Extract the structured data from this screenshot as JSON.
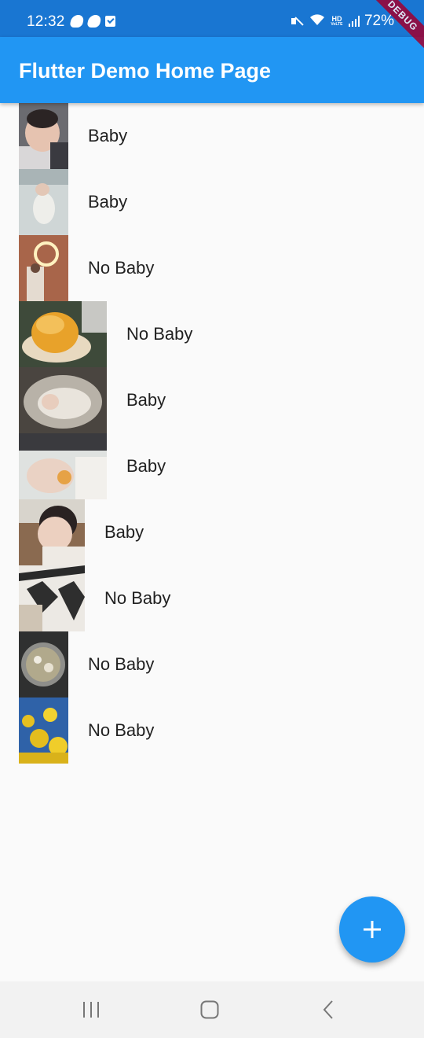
{
  "status_bar": {
    "time": "12:32",
    "battery": "72%",
    "hd_label": "HD",
    "hd_sub": "VoLTE",
    "left_icons": [
      "cloud-icon",
      "cloud-icon",
      "task-check-icon"
    ],
    "right_icons": [
      "mute-icon",
      "wifi-icon",
      "signal-icon"
    ]
  },
  "debug_banner": "DEBUG",
  "app_bar": {
    "title": "Flutter Demo Home Page",
    "color": "#2196F3"
  },
  "items": [
    {
      "label": "Baby"
    },
    {
      "label": "Baby"
    },
    {
      "label": "No Baby"
    },
    {
      "label": "No Baby"
    },
    {
      "label": "Baby"
    },
    {
      "label": "Baby"
    },
    {
      "label": "Baby"
    },
    {
      "label": "No Baby"
    },
    {
      "label": "No Baby"
    },
    {
      "label": "No Baby"
    }
  ],
  "fab": {
    "icon": "plus-icon",
    "color": "#2196F3"
  },
  "nav_bar": {
    "icons": [
      "recent-apps-icon",
      "home-icon",
      "back-icon"
    ]
  }
}
